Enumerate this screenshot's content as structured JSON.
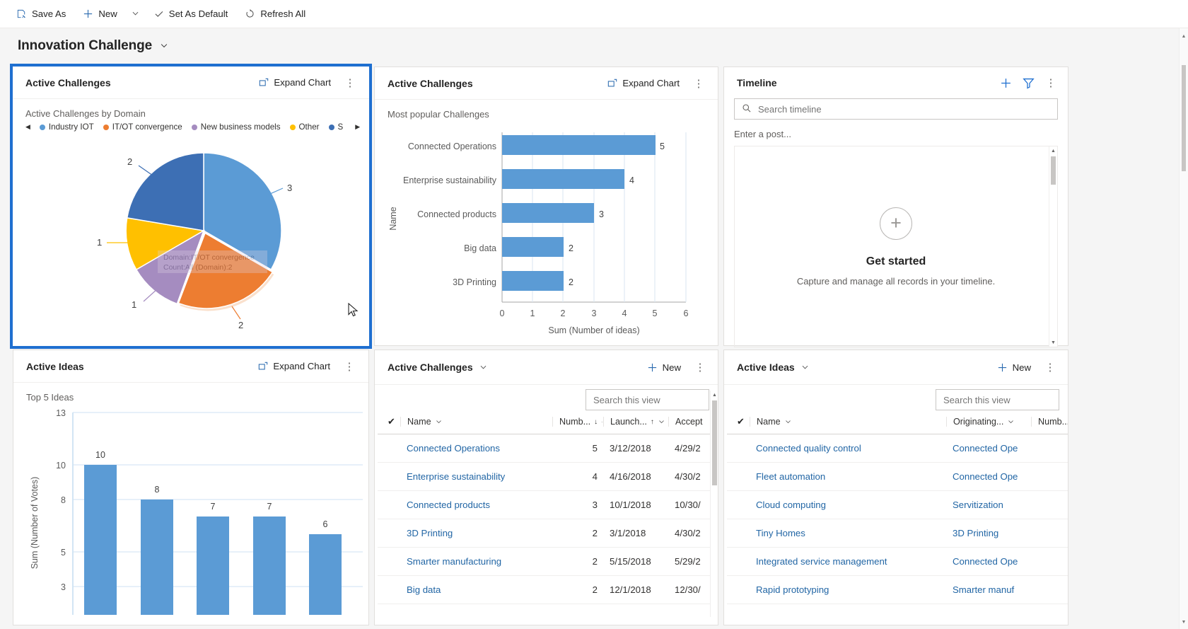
{
  "commandbar": {
    "items": [
      {
        "label": "Save As",
        "icon": "save-as-icon"
      },
      {
        "label": "New",
        "icon": "plus-icon",
        "caret": true
      },
      {
        "label": "Set As Default",
        "icon": "check-icon"
      },
      {
        "label": "Refresh All",
        "icon": "refresh-icon"
      }
    ]
  },
  "page": {
    "title": "Innovation Challenge",
    "chevron": "chevron-down-icon"
  },
  "tiles": {
    "pie": {
      "title": "Active Challenges",
      "expand_label": "Expand Chart",
      "subtitle": "Active Challenges by Domain",
      "tooltip": {
        "line1": "Domain:IT/OT convergence",
        "line2": "Count:All (Domain):2"
      }
    },
    "bar": {
      "title": "Active Challenges",
      "expand_label": "Expand Chart",
      "subtitle": "Most popular Challenges"
    },
    "timeline": {
      "title": "Timeline",
      "search_placeholder": "Search timeline",
      "post_placeholder": "Enter a post...",
      "empty_title": "Get started",
      "empty_sub": "Capture and manage all records in your timeline."
    },
    "ideas_chart": {
      "title": "Active Ideas",
      "expand_label": "Expand Chart",
      "subtitle": "Top 5 Ideas"
    },
    "challenges_grid": {
      "title": "Active Challenges",
      "new_label": "New",
      "search_placeholder": "Search this view",
      "columns": [
        "Name",
        "Numb...",
        "Launch...",
        "Accept"
      ],
      "sort": {
        "col2": "down-arrow-icon",
        "col3": "up-arrow-icon"
      },
      "rows": [
        {
          "name": "Connected Operations",
          "number": "5",
          "launch": "3/12/2018",
          "accept": "4/29/2"
        },
        {
          "name": "Enterprise sustainability",
          "number": "4",
          "launch": "4/16/2018",
          "accept": "4/30/2"
        },
        {
          "name": "Connected products",
          "number": "3",
          "launch": "10/1/2018",
          "accept": "10/30/"
        },
        {
          "name": "3D Printing",
          "number": "2",
          "launch": "3/1/2018",
          "accept": "4/30/2"
        },
        {
          "name": "Smarter manufacturing",
          "number": "2",
          "launch": "5/15/2018",
          "accept": "5/29/2"
        },
        {
          "name": "Big data",
          "number": "2",
          "launch": "12/1/2018",
          "accept": "12/30/"
        }
      ]
    },
    "ideas_grid": {
      "title": "Active Ideas",
      "new_label": "New",
      "search_placeholder": "Search this view",
      "columns": [
        "Name",
        "Originating...",
        "Numb..."
      ],
      "rows": [
        {
          "name": "Connected quality control",
          "originating": "Connected Ope"
        },
        {
          "name": "Fleet automation",
          "originating": "Connected Ope"
        },
        {
          "name": "Cloud computing",
          "originating": "Servitization"
        },
        {
          "name": "Tiny Homes",
          "originating": "3D Printing"
        },
        {
          "name": "Integrated service management",
          "originating": "Connected Ope"
        },
        {
          "name": "Rapid prototyping",
          "originating": "Smarter manuf"
        }
      ]
    }
  },
  "colors": {
    "accent": "#1f6fd0",
    "bar": "#5b9bd5",
    "link": "#2266a5",
    "pie": [
      "#5b9bd5",
      "#ed7d31",
      "#a58cc0",
      "#ffc000",
      "#3d6fb4"
    ]
  },
  "chart_data": [
    {
      "type": "pie",
      "title": "Active Challenges by Domain",
      "legend_position": "top",
      "categories": [
        "Industry IOT",
        "IT/OT convergence",
        "New business models",
        "Other",
        "S"
      ],
      "legend_labels": [
        "Industry IOT",
        "IT/OT convergence",
        "New business models",
        "Other",
        "S"
      ],
      "values": [
        3,
        2,
        1,
        1,
        2
      ],
      "colors": [
        "#5b9bd5",
        "#ed7d31",
        "#a58cc0",
        "#ffc000",
        "#3d6fb4"
      ],
      "data_labels": [
        "3",
        "2",
        "1",
        "1",
        "2"
      ],
      "exploded_index": 1
    },
    {
      "type": "bar",
      "orientation": "horizontal",
      "title": "Most popular Challenges",
      "ylabel": "Name",
      "xlabel": "Sum (Number of ideas)",
      "categories": [
        "Connected Operations",
        "Enterprise sustainability",
        "Connected products",
        "Big data",
        "3D Printing"
      ],
      "values": [
        5,
        4,
        3,
        2,
        2
      ],
      "data_labels": [
        "5",
        "4",
        "3",
        "2",
        "2"
      ],
      "xticks": [
        "0",
        "1",
        "2",
        "3",
        "4",
        "5",
        "6"
      ],
      "xlim": [
        0,
        6
      ],
      "grid": true,
      "color": "#5b9bd5"
    },
    {
      "type": "bar",
      "orientation": "vertical",
      "title": "Top 5 Ideas",
      "ylabel": "Sum (Number of Votes)",
      "xlabel": "",
      "categories": [
        "",
        "",
        "",
        "",
        ""
      ],
      "values": [
        10,
        8,
        7,
        7,
        6
      ],
      "data_labels": [
        "10",
        "8",
        "7",
        "7",
        "6"
      ],
      "yticks": [
        "13",
        "10",
        "8",
        "5",
        "3"
      ],
      "ylim": [
        0,
        13
      ],
      "grid": true,
      "color": "#5b9bd5"
    }
  ]
}
